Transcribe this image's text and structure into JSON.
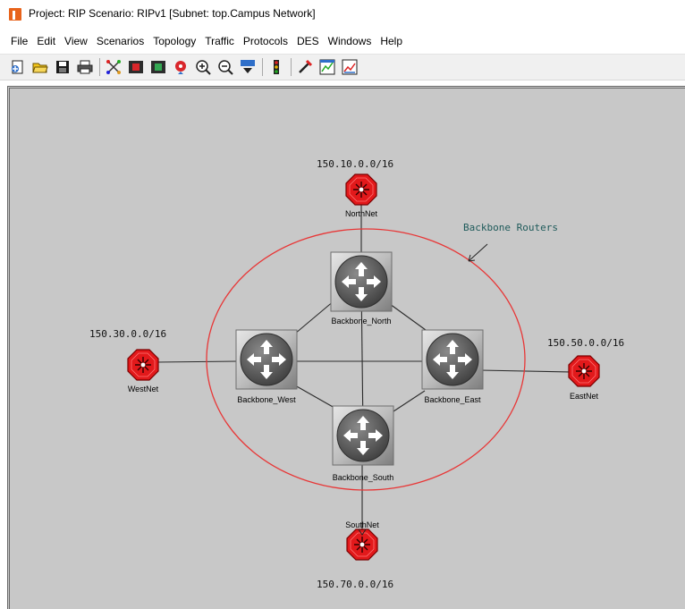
{
  "window": {
    "title": "Project: RIP Scenario: RIPv1  [Subnet: top.Campus Network]"
  },
  "menu": [
    "File",
    "Edit",
    "View",
    "Scenarios",
    "Topology",
    "Traffic",
    "Protocols",
    "DES",
    "Windows",
    "Help"
  ],
  "toolbar": {
    "icons": [
      "new-project-icon",
      "open-icon",
      "save-icon",
      "print-icon",
      "object-palette-icon",
      "configure-icon",
      "verify-links-icon",
      "failure-recovery-icon",
      "zoom-in-icon",
      "zoom-out-icon",
      "view-ace-icon",
      "run-simulation-icon",
      "results-icon",
      "view-results-icon",
      "compare-results-icon"
    ]
  },
  "canvas": {
    "annotation": "Backbone Routers",
    "backbone_routers": [
      {
        "id": "north",
        "label": "Backbone_North"
      },
      {
        "id": "west",
        "label": "Backbone_West"
      },
      {
        "id": "east",
        "label": "Backbone_East"
      },
      {
        "id": "south",
        "label": "Backbone_South"
      }
    ],
    "subnets": [
      {
        "id": "north",
        "label": "NorthNet",
        "address": "150.10.0.0/16"
      },
      {
        "id": "west",
        "label": "WestNet",
        "address": "150.30.0.0/16"
      },
      {
        "id": "east",
        "label": "EastNet",
        "address": "150.50.0.0/16"
      },
      {
        "id": "south",
        "label": "SouthNet",
        "address": "150.70.0.0/16"
      }
    ],
    "colors": {
      "background": "#c8c8c8",
      "subnet_red": "#e2191b",
      "ellipse_red": "#e83636",
      "annotation_teal": "#1e5a5a",
      "link": "#2b2b2b"
    }
  }
}
